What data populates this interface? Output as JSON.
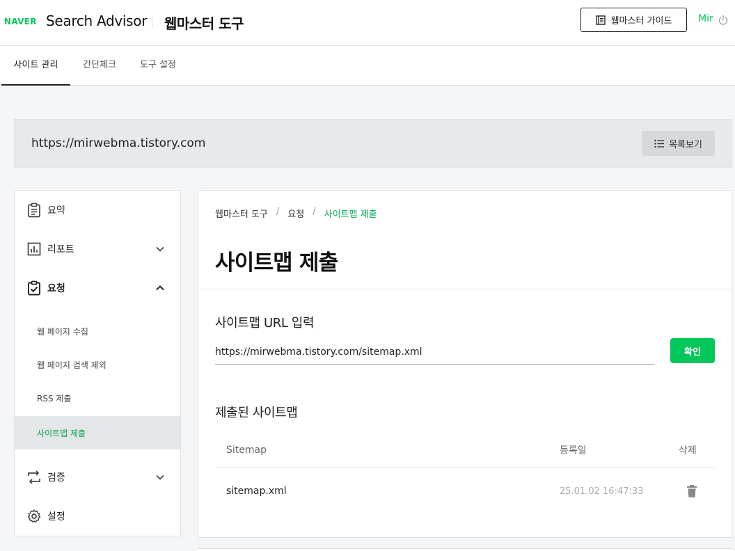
{
  "header": {
    "naver_logo": "NAVER",
    "product_name": "Search Advisor",
    "section_name": "웹마스터 도구",
    "guide_button": "웹마스터 가이드",
    "user_name": "Mir"
  },
  "tabs": [
    {
      "label": "사이트 관리",
      "active": true
    },
    {
      "label": "간단체크",
      "active": false
    },
    {
      "label": "도구 설정",
      "active": false
    }
  ],
  "site": {
    "url": "https://mirwebma.tistory.com",
    "list_button": "목록보기"
  },
  "sidebar": {
    "items": [
      {
        "label": "요약",
        "icon": "clipboard-icon"
      },
      {
        "label": "리포트",
        "icon": "chart-icon",
        "expanded": false
      },
      {
        "label": "요청",
        "icon": "clipboard-check-icon",
        "expanded": true
      },
      {
        "label": "검증",
        "icon": "repeat-icon",
        "expanded": false
      },
      {
        "label": "설정",
        "icon": "gear-icon"
      }
    ],
    "sub_items": [
      {
        "label": "웹 페이지 수집"
      },
      {
        "label": "웹 페이지 검색 제외"
      },
      {
        "label": "RSS 제출"
      },
      {
        "label": "사이트맵 제출",
        "active": true
      }
    ]
  },
  "main": {
    "breadcrumb": [
      "웹마스터 도구",
      "요청",
      "사이트맵 제출"
    ],
    "breadcrumb_sep": "/",
    "title": "사이트맵 제출",
    "url_section_title": "사이트맵 URL 입력",
    "url_input_value": "https://mirwebma.tistory.com/sitemap.xml",
    "confirm_button": "확인",
    "submitted_title": "제출된 사이트맵",
    "table": {
      "headers": [
        "Sitemap",
        "등록일",
        "삭제"
      ],
      "rows": [
        {
          "sitemap": "sitemap.xml",
          "date": "25.01.02 16:47:33"
        }
      ]
    }
  },
  "colors": {
    "brand_green": "#03c75a",
    "active_green": "#03a94e"
  }
}
